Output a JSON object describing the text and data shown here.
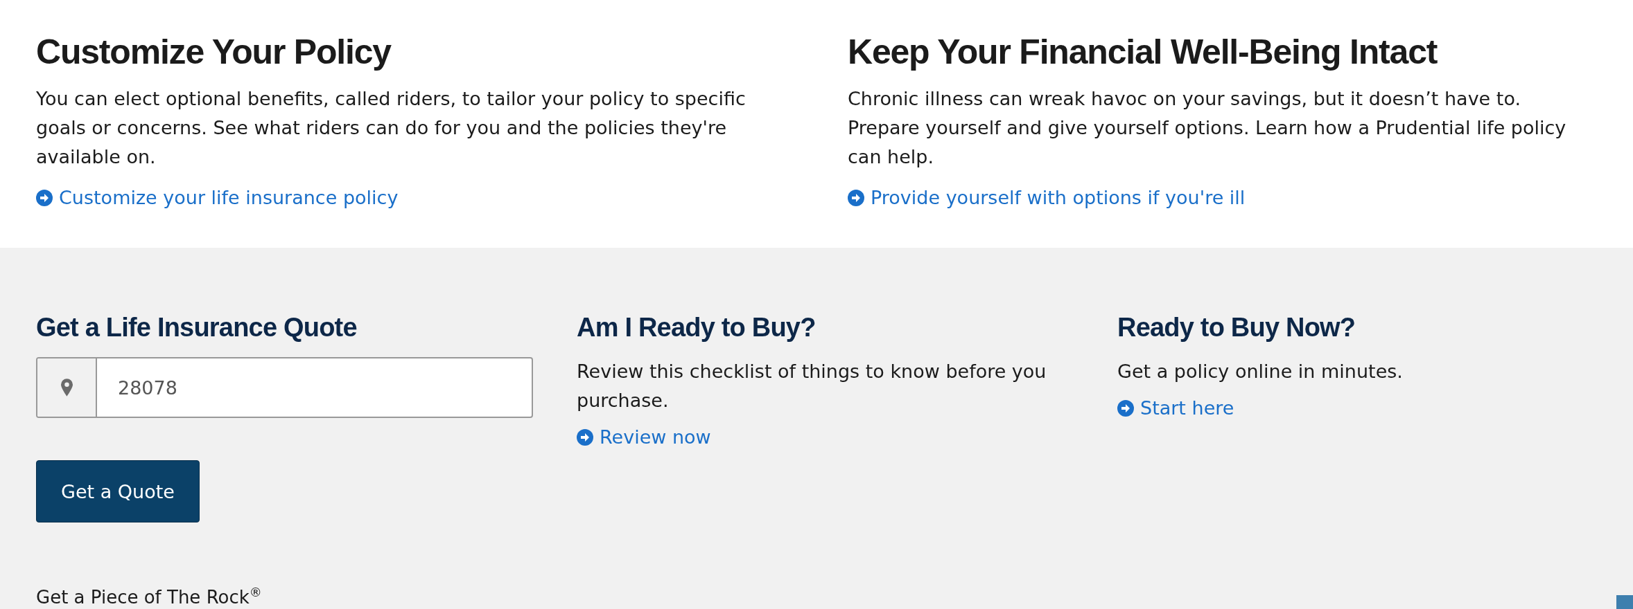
{
  "features": [
    {
      "heading": "Customize Your Policy",
      "body": "You can elect optional benefits, called riders, to tailor your policy to specific goals or concerns. See what riders can do for you and the policies they're available on.",
      "link": "Customize your life insurance policy"
    },
    {
      "heading": "Keep Your Financial Well-Being Intact",
      "body": "Chronic illness can wreak havoc on your savings, but it doesn’t have to. Prepare yourself and give yourself options. Learn how a Prudential life policy can help.",
      "link": "Provide yourself with options if you're ill"
    }
  ],
  "quote": {
    "heading": "Get a Life Insurance Quote",
    "zip_field": {
      "value": "28078"
    },
    "button": "Get a Quote"
  },
  "columns": [
    {
      "heading": "Am I Ready to Buy?",
      "body": "Review this checklist of things to know before you purchase.",
      "link": "Review now"
    },
    {
      "heading": "Ready to Buy Now?",
      "body": "Get a policy online in minutes.",
      "link": "Start here"
    }
  ],
  "footer": {
    "text": "Get a Piece of The Rock$^{®}$"
  }
}
